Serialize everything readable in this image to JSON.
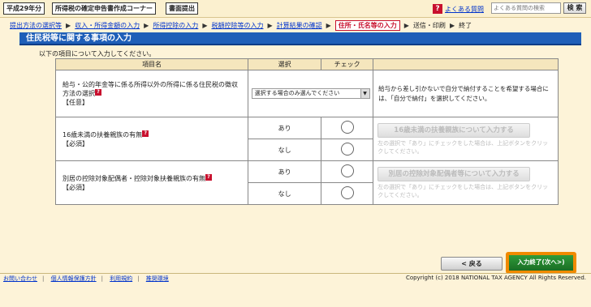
{
  "header": {
    "tags": [
      "平成29年分",
      "所得税の確定申告書作成コーナー",
      "書面提出"
    ],
    "faq_icon": "?",
    "faq_label": "よくある質問",
    "search_placeholder": "よくある質問の検索",
    "search_button": "検 索"
  },
  "steps": [
    {
      "label": "提出方法の選択等",
      "state": "done"
    },
    {
      "label": "収入・所得金額の入力",
      "state": "done"
    },
    {
      "label": "所得控除の入力",
      "state": "done"
    },
    {
      "label": "税額控除等の入力",
      "state": "done"
    },
    {
      "label": "計算結果の確認",
      "state": "done"
    },
    {
      "label": "住所・氏名等の入力",
      "state": "current"
    },
    {
      "label": "送信・印刷",
      "state": "future"
    },
    {
      "label": "終了",
      "state": "future"
    }
  ],
  "arrow_glyph": "▶",
  "page_title": "住民税等に関する事項の入力",
  "intro": "以下の項目について入力してください。",
  "table": {
    "headers": {
      "item": "項目名",
      "select": "選択",
      "check": "チェック"
    },
    "row1": {
      "label": "給与・公的年金等に係る所得以外の所得に係る住民税の徴収方法の選択",
      "qm": "?",
      "tag": "【任意】",
      "select_value": "選択する場合のみ選んでください",
      "desc": "給与から差し引かないで自分で納付することを希望する場合には、「自分で納付」を選択してください。"
    },
    "row2": {
      "label": "16歳未満の扶養親族の有無",
      "qm": "?",
      "tag": "【必須】",
      "opt_yes": "あり",
      "opt_no": "なし",
      "button": "16歳未満の扶養親族について入力する",
      "note": "左の選択で「あり」にチェックをした場合は、上記ボタンをクリックしてください。"
    },
    "row3": {
      "label": "別居の控除対象配偶者・控除対象扶養親族の有無",
      "qm": "?",
      "tag": "【必須】",
      "opt_yes": "あり",
      "opt_no": "なし",
      "button": "別居の控除対象配偶者等について入力する",
      "note": "左の選択で「あり」にチェックをした場合は、上記ボタンをクリックしてください。"
    }
  },
  "buttons": {
    "back": "< 戻る",
    "next": "入力終了(次へ>)"
  },
  "footer": {
    "links": [
      "お問い合わせ",
      "個人情報保護方針",
      "利用規約",
      "推奨環境"
    ],
    "separator": "|",
    "copyright": "Copyright (c) 2018 NATIONAL TAX AGENCY All Rights Reserved."
  },
  "colors": {
    "title_bar": "#1f5fb8",
    "current_step": "#c8102e",
    "next_button": "#2f9b3a",
    "next_highlight": "#f18a00"
  }
}
